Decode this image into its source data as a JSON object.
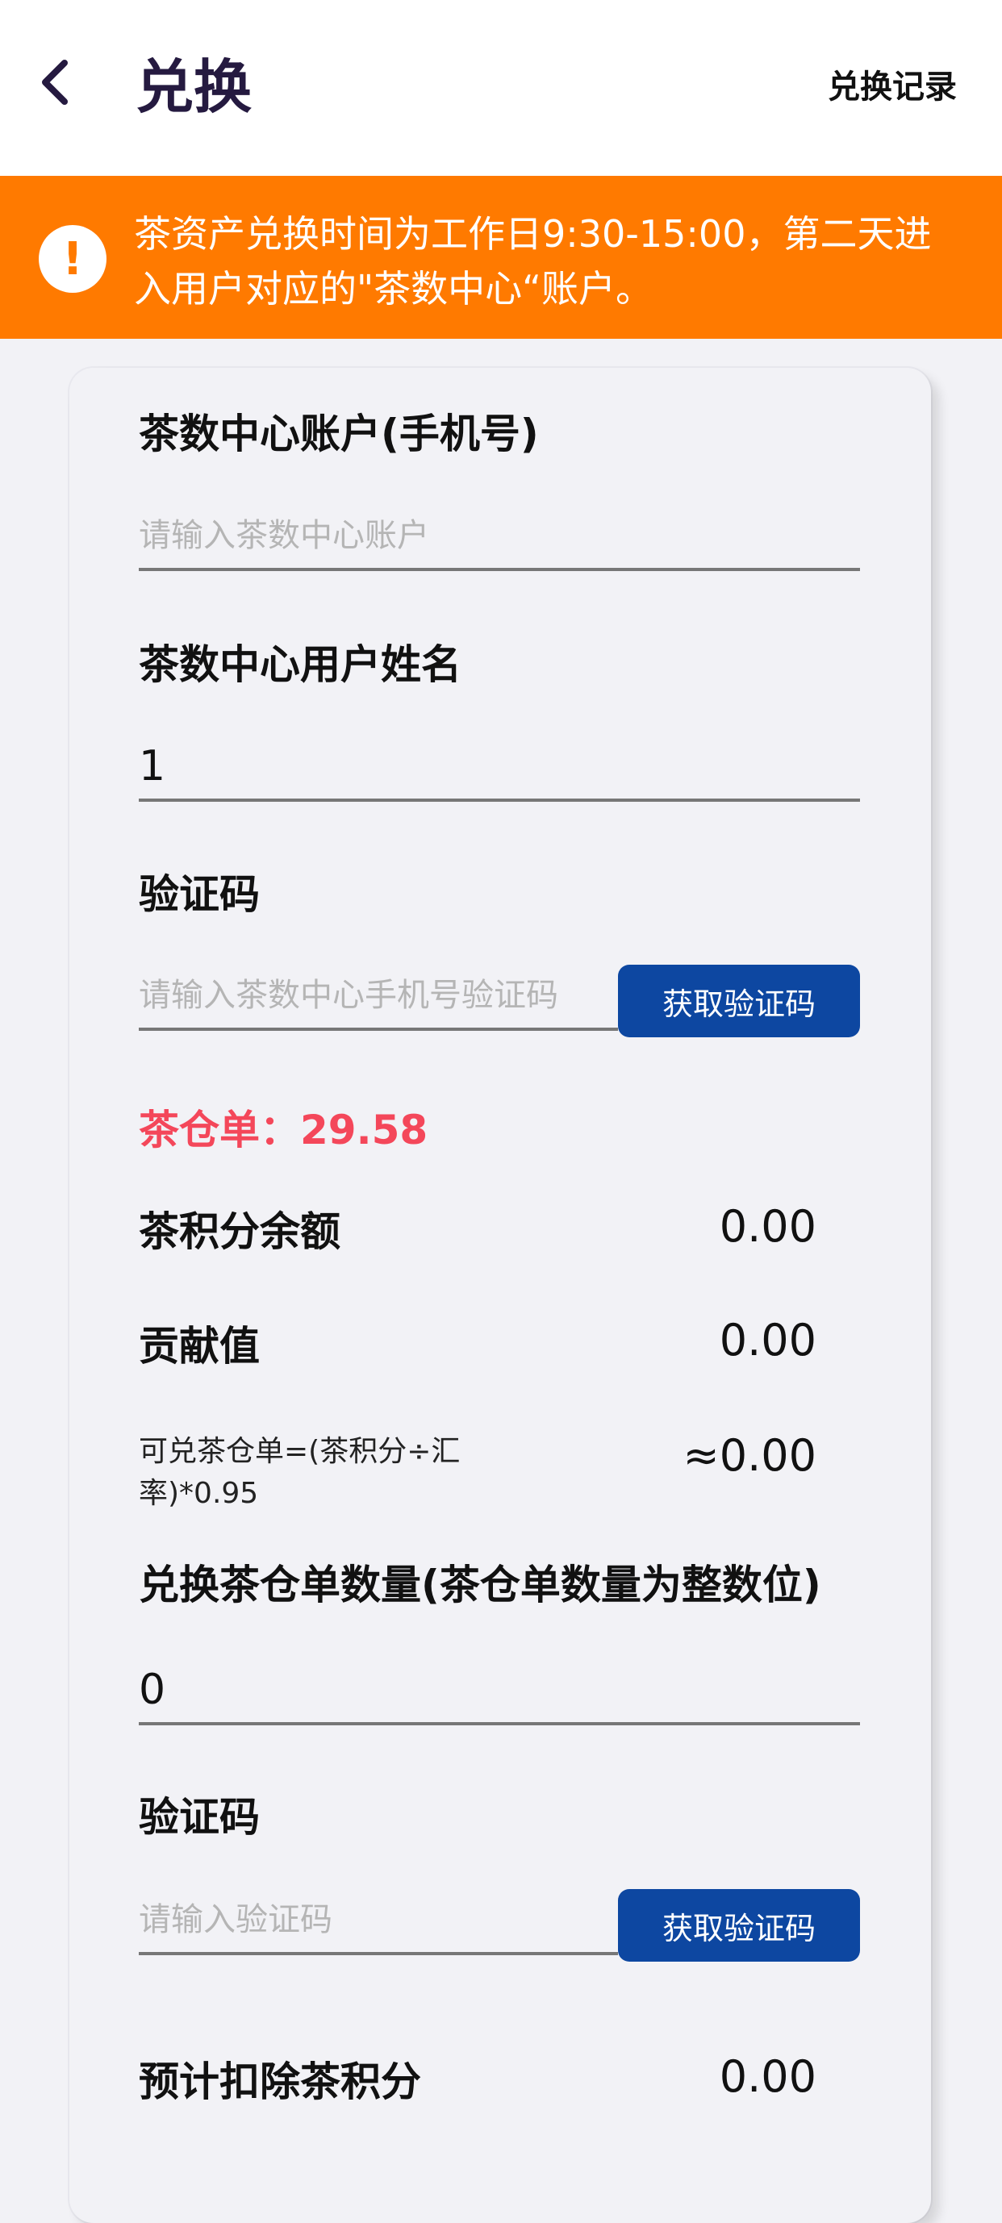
{
  "header": {
    "title": "兑换",
    "record_link": "兑换记录"
  },
  "notice": {
    "text": "茶资产兑换时间为工作日9:30-15:00，第二天进入用户对应的\"茶数中心“账户。"
  },
  "form": {
    "account_label": "茶数中心账户(手机号)",
    "account_placeholder": "请输入茶数中心账户",
    "name_label": "茶数中心用户姓名",
    "name_value": "1",
    "code1_label": "验证码",
    "code1_placeholder": "请输入茶数中心手机号验证码",
    "code1_button": "获取验证码",
    "warehouse_text": "茶仓单：29.58",
    "points_label": "茶积分余额",
    "points_value": "0.00",
    "contribution_label": "贡献值",
    "contribution_value": "0.00",
    "formula_text": "可兑茶仓单=(茶积分÷汇率)*0.95",
    "formula_value": "≈0.00",
    "quantity_label": "兑换茶仓单数量(茶仓单数量为整数位)",
    "quantity_value": "0",
    "code2_label": "验证码",
    "code2_placeholder": "请输入验证码",
    "code2_button": "获取验证码",
    "deduct_label": "预计扣除茶积分",
    "deduct_value": "0.00"
  }
}
